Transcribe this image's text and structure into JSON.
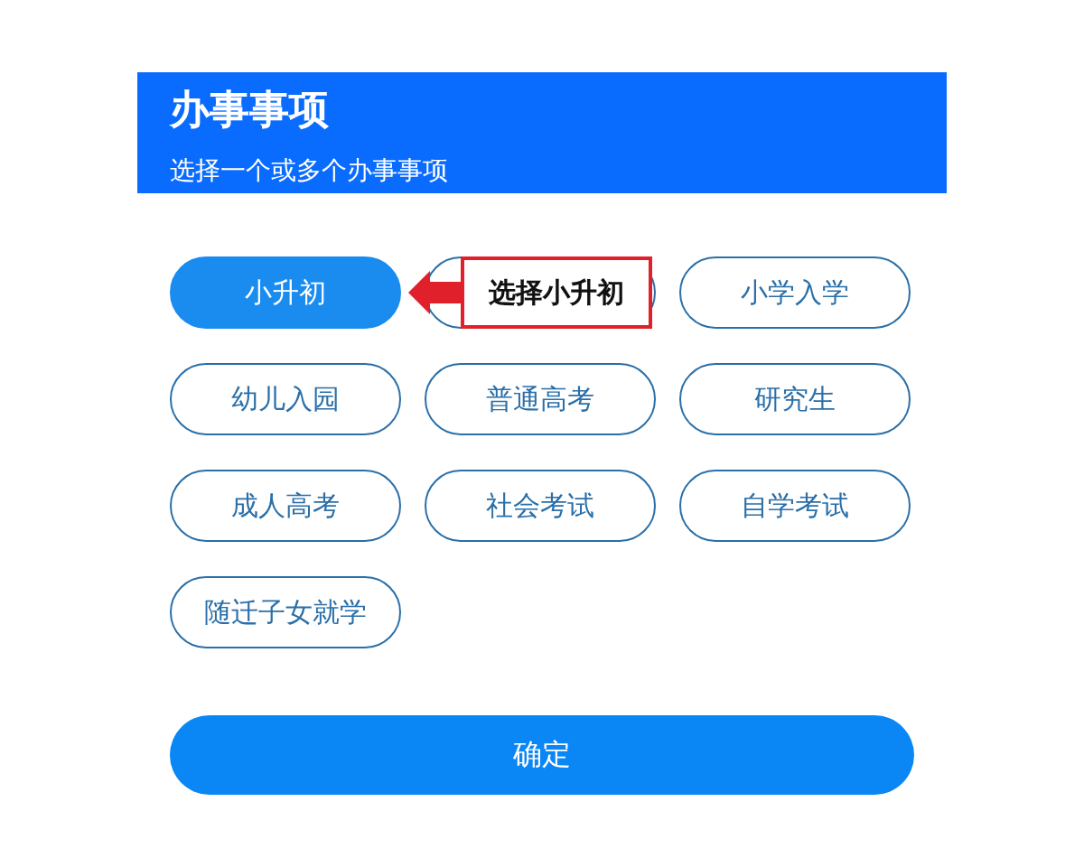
{
  "header": {
    "title": "办事事项",
    "subtitle": "选择一个或多个办事事项"
  },
  "options": [
    {
      "label": "小升初",
      "selected": true
    },
    {
      "selected": false
    },
    {
      "label": "小学入学",
      "selected": false
    },
    {
      "label": "幼儿入园",
      "selected": false
    },
    {
      "label": "普通高考",
      "selected": false
    },
    {
      "label": "研究生",
      "selected": false
    },
    {
      "label": "成人高考",
      "selected": false
    },
    {
      "label": "社会考试",
      "selected": false
    },
    {
      "label": "自学考试",
      "selected": false
    },
    {
      "label": "随迁子女就学",
      "selected": false
    }
  ],
  "callout": {
    "text": "选择小升初"
  },
  "confirm_button": "确定"
}
